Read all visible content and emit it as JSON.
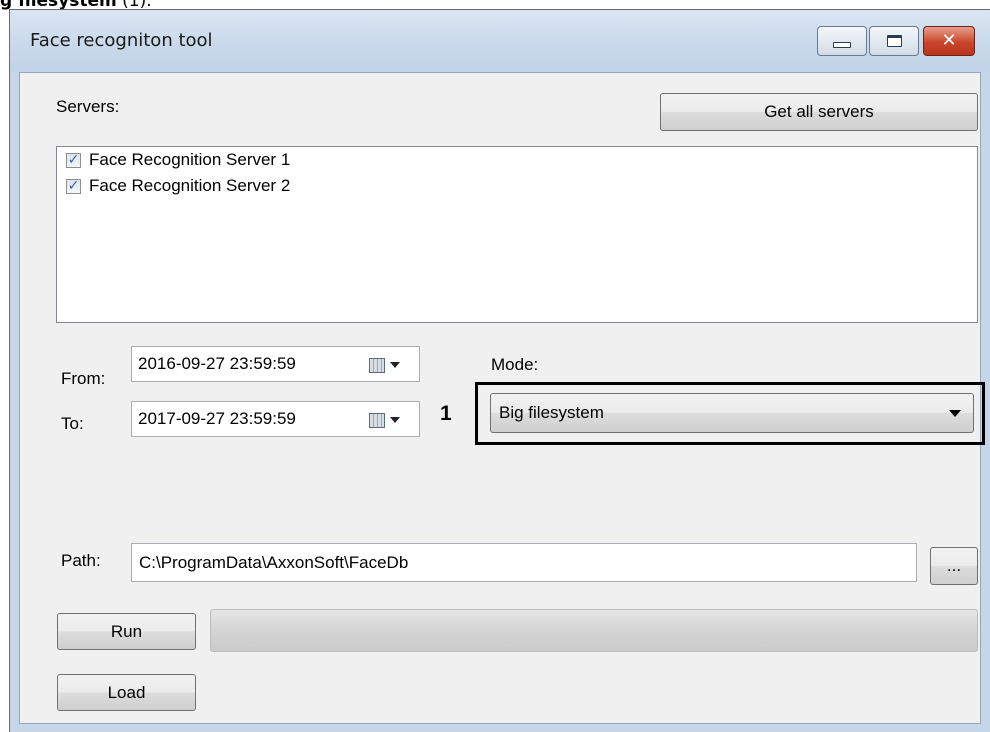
{
  "caption": {
    "bold": "g filesystem",
    "rest": " (1)."
  },
  "window": {
    "title": "Face recogniton tool",
    "close_glyph": "✕"
  },
  "servers": {
    "label": "Servers:",
    "get_all_label": "Get all servers",
    "items": [
      {
        "label": "Face Recognition Server 1",
        "checked": true,
        "check_glyph": "✓"
      },
      {
        "label": "Face Recognition Server 2",
        "checked": true,
        "check_glyph": "✓"
      }
    ]
  },
  "range": {
    "from_label": "From:",
    "from_value": "2016-09-27 23:59:59",
    "to_label": "To:",
    "to_value": "2017-09-27 23:59:59"
  },
  "mode": {
    "label": "Mode:",
    "selected": "Big filesystem",
    "callout": "1"
  },
  "path": {
    "label": "Path:",
    "value": "C:\\ProgramData\\AxxonSoft\\FaceDb",
    "browse_label": "..."
  },
  "actions": {
    "run_label": "Run",
    "load_label": "Load"
  },
  "progress": {
    "value": 0
  },
  "icons": {
    "calendar": "calendar-icon",
    "dropdown": "chevron-down-icon",
    "checkbox": "checkmark-icon"
  }
}
